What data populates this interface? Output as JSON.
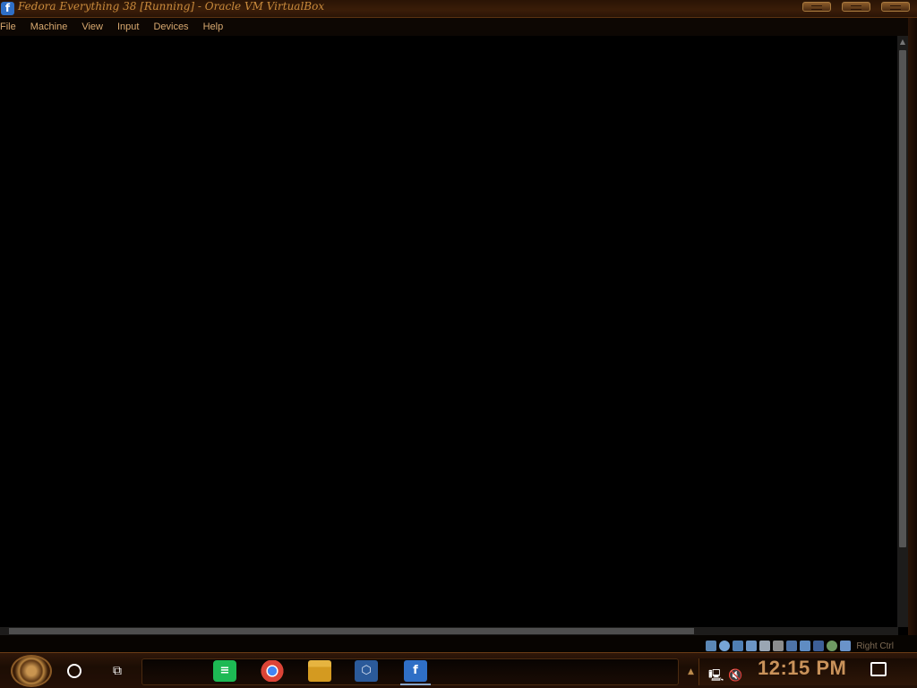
{
  "window": {
    "title": "Fedora Everything 38 [Running] - Oracle VM VirtualBox",
    "app_icon": "fedora-icon",
    "controls": [
      "minimize",
      "maximize",
      "close"
    ]
  },
  "menu": {
    "items": [
      "File",
      "Machine",
      "View",
      "Input",
      "Devices",
      "Help"
    ]
  },
  "statusbar": {
    "icons": [
      "hard-disk-icon",
      "optical-drive-icon",
      "audio-icon",
      "network-icon",
      "usb-icon",
      "shared-folders-icon",
      "display-icon",
      "recording-icon",
      "virtualization-icon",
      "cpu-icon",
      "mouse-icon"
    ],
    "host_key": "Right Ctrl"
  },
  "taskbar": {
    "apps": [
      {
        "name": "Spotify-like app",
        "icon": "spotify-icon",
        "color": "#1db954"
      },
      {
        "name": "Google Chrome",
        "icon": "chrome-icon",
        "color": "#4285f4"
      },
      {
        "name": "File Explorer",
        "icon": "folder-icon",
        "color": "#e6b440"
      },
      {
        "name": "Oracle VM VirtualBox",
        "icon": "virtualbox-icon",
        "color": "#2b5a9a"
      },
      {
        "name": "Fedora",
        "icon": "fedora-icon",
        "color": "#2f6fc6"
      }
    ],
    "clock": "12:15 PM"
  },
  "colors": {
    "title_text": "#c98a3c",
    "menu_text": "#d8a970",
    "taskbar_bg": "#241006",
    "clock_text": "#c9925a"
  }
}
